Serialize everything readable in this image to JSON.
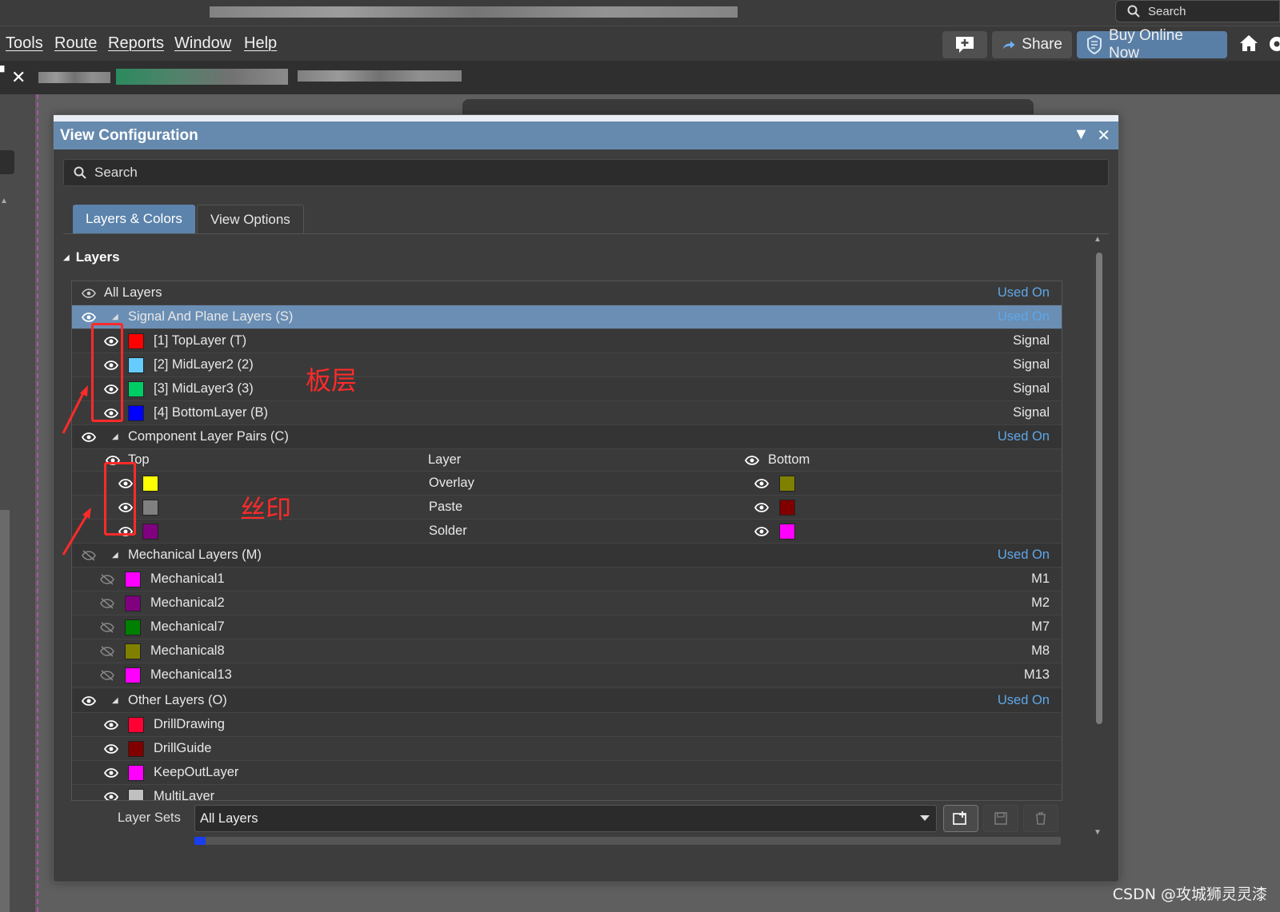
{
  "header": {
    "search_label": "Search"
  },
  "menubar": {
    "items": [
      "Tools",
      "Route",
      "Reports",
      "Window",
      "Help"
    ],
    "share_label": "Share",
    "buy_label": "Buy Online Now"
  },
  "panel": {
    "title": "View Configuration",
    "search_placeholder": "Search",
    "tabs": [
      "Layers & Colors",
      "View Options"
    ],
    "section_title": "Layers"
  },
  "layers": {
    "all_layers": {
      "label": "All Layers",
      "status": "Used On"
    },
    "signal_group": {
      "label": "Signal And Plane Layers (S)",
      "status": "Used On"
    },
    "signal_layers": [
      {
        "label": "[1] TopLayer (T)",
        "type": "Signal",
        "color": "#ff0000"
      },
      {
        "label": "[2] MidLayer2 (2)",
        "type": "Signal",
        "color": "#66ccff"
      },
      {
        "label": "[3] MidLayer3 (3)",
        "type": "Signal",
        "color": "#00cc66"
      },
      {
        "label": "[4] BottomLayer (B)",
        "type": "Signal",
        "color": "#0000ff"
      }
    ],
    "component_group": {
      "label": "Component Layer Pairs (C)",
      "status": "Used On"
    },
    "component_header": {
      "top": "Top",
      "layer": "Layer",
      "bottom": "Bottom"
    },
    "component_pairs": [
      {
        "name": "Overlay",
        "top_color": "#ffff00",
        "bottom_color": "#808000"
      },
      {
        "name": "Paste",
        "top_color": "#808080",
        "bottom_color": "#800000"
      },
      {
        "name": "Solder",
        "top_color": "#800080",
        "bottom_color": "#ff00ff"
      }
    ],
    "mechanical_group": {
      "label": "Mechanical Layers (M)",
      "status": "Used On"
    },
    "mechanical_layers": [
      {
        "label": "Mechanical1",
        "code": "M1",
        "color": "#ff00ff"
      },
      {
        "label": "Mechanical2",
        "code": "M2",
        "color": "#800080"
      },
      {
        "label": "Mechanical7",
        "code": "M7",
        "color": "#008000"
      },
      {
        "label": "Mechanical8",
        "code": "M8",
        "color": "#808000"
      },
      {
        "label": "Mechanical13",
        "code": "M13",
        "color": "#ff00ff"
      }
    ],
    "other_group": {
      "label": "Other Layers (O)",
      "status": "Used On"
    },
    "other_layers": [
      {
        "label": "DrillDrawing",
        "color": "#ff0033"
      },
      {
        "label": "DrillGuide",
        "color": "#800000"
      },
      {
        "label": "KeepOutLayer",
        "color": "#ff00ff"
      },
      {
        "label": "MultiLayer",
        "color": "#c0c0c0"
      }
    ]
  },
  "layer_sets": {
    "label": "Layer Sets",
    "selected": "All Layers",
    "progress_fraction": 0.01
  },
  "annotations": {
    "board_layer": "板层",
    "silkscreen": "丝印",
    "watermark": "CSDN @攻城狮灵灵漆"
  },
  "colors": {
    "accent": "#668aae",
    "used_on": "#5fa7e8",
    "annotation": "#ff2a2a"
  }
}
